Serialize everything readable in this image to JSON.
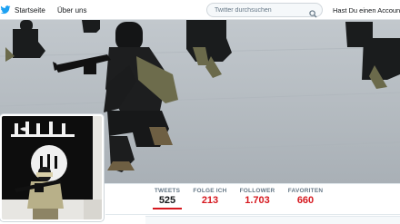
{
  "nav": {
    "home_label": "Startseite",
    "about_label": "Über uns",
    "search_placeholder": "Twitter durchsuchen",
    "signup_text": "Hast Du einen Account?"
  },
  "profile": {
    "banner_alt": "photo of armed masked men crouching in a gym",
    "avatar_alt": "photo of an armed masked man in front of a black flag"
  },
  "stats": [
    {
      "label": "TWEETS",
      "value": "525",
      "active": true
    },
    {
      "label": "FOLGE ICH",
      "value": "213",
      "active": false
    },
    {
      "label": "FOLLOWER",
      "value": "1.703",
      "active": false
    },
    {
      "label": "FAVORITEN",
      "value": "660",
      "active": false
    }
  ],
  "colors": {
    "brand_blue": "#1da1f2",
    "stat_value_red": "#d6181f",
    "active_underline": "#d6181f",
    "label_gray": "#657786"
  },
  "icons": {
    "home": "twitter-bird-icon",
    "search": "search-icon"
  }
}
